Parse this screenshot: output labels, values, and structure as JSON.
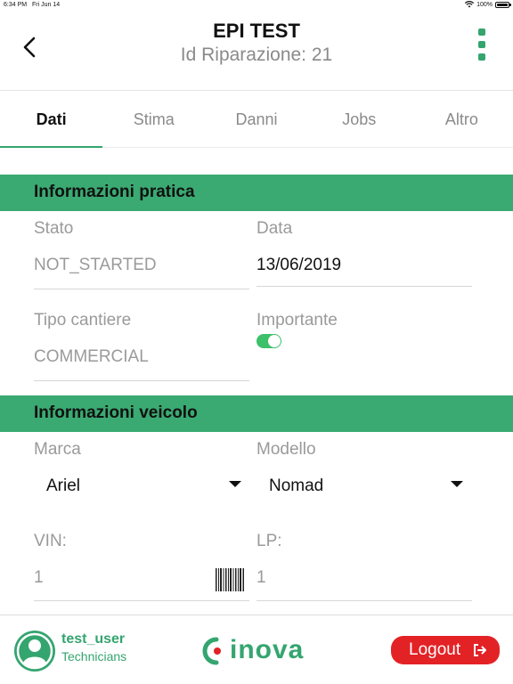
{
  "status_bar": {
    "time": "6:34 PM",
    "date": "Fri Jun 14",
    "battery": "100%",
    "battery_level": 1.0
  },
  "header": {
    "title": "EPI TEST",
    "subtitle": "Id Riparazione: 21"
  },
  "tabs": [
    {
      "label": "Dati",
      "active": true
    },
    {
      "label": "Stima",
      "active": false
    },
    {
      "label": "Danni",
      "active": false
    },
    {
      "label": "Jobs",
      "active": false
    },
    {
      "label": "Altro",
      "active": false
    }
  ],
  "pratica": {
    "title": "Informazioni pratica",
    "stato": {
      "label": "Stato",
      "value": "NOT_STARTED"
    },
    "data": {
      "label": "Data",
      "value": "13/06/2019"
    },
    "tipo_cantiere": {
      "label": "Tipo cantiere",
      "value": "COMMERCIAL"
    },
    "importante": {
      "label": "Importante",
      "checked": true
    }
  },
  "veicolo": {
    "title": "Informazioni veicolo",
    "marca": {
      "label": "Marca",
      "value": "Ariel"
    },
    "modello": {
      "label": "Modello",
      "value": "Nomad"
    },
    "vin": {
      "label": "VIN:",
      "value": "1"
    },
    "lp": {
      "label": "LP:",
      "value": "1"
    }
  },
  "footer": {
    "user_name": "test_user",
    "user_role": "Technicians",
    "logo_text": "inova",
    "logout_label": "Logout"
  },
  "colors": {
    "accent": "#3aaa72",
    "logout": "#e32226",
    "toggle": "#3cc06a"
  }
}
